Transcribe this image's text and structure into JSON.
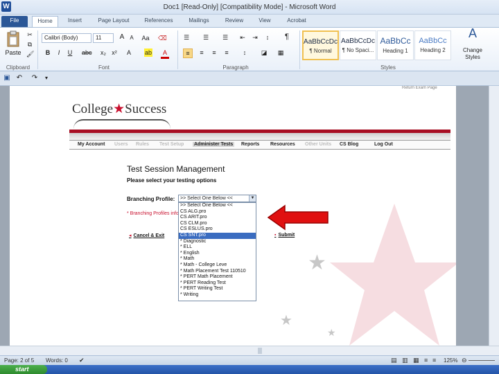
{
  "window": {
    "title": "Doc1 [Read-Only] [Compatibility Mode] - Microsoft Word",
    "app_icon": "W"
  },
  "tabs": [
    "File",
    "Home",
    "Insert",
    "Page Layout",
    "References",
    "Mailings",
    "Review",
    "View",
    "Acrobat"
  ],
  "ribbon": {
    "clipboard": {
      "paste": "Paste",
      "label": "Clipboard"
    },
    "font": {
      "family": "Calibri (Body)",
      "size": "11",
      "label": "Font"
    },
    "paragraph": {
      "label": "Paragraph"
    },
    "styles": {
      "items": [
        {
          "sample": "AaBbCcDc",
          "name": "¶ Normal"
        },
        {
          "sample": "AaBbCcDc",
          "name": "¶ No Spaci..."
        },
        {
          "sample": "AaBbCc",
          "name": "Heading 1"
        },
        {
          "sample": "AaBbCc",
          "name": "Heading 2"
        }
      ],
      "change": "Change Styles",
      "label": "Styles"
    }
  },
  "document": {
    "top_right_text": "Return Exam Page",
    "logo": {
      "left": "College",
      "star": "★",
      "right": "Success"
    },
    "nav": [
      "My Account",
      "Users",
      "Rules",
      "Test Setup",
      "Administer Tests",
      "Reports",
      "Resources",
      "Other Units",
      "CS Blog",
      "Log Out"
    ],
    "heading": "Test Session Management",
    "subheading": "Please select your testing options",
    "branching_label": "Branching Profile:",
    "select_value": ">> Select One Below <<",
    "note": "* Branching Profiles info",
    "options": [
      ">> Select One Below <<",
      "CS ALG.pro",
      "CS ARIT.pro",
      "CS CLM.pro",
      "CS ESLUS.pro",
      "CS SNT.pro",
      "* Diagnostic",
      "* ELL",
      "* English",
      "* Math",
      "* Math - College Leve",
      "* Math Placement Test 110510",
      "* PERT Math Placement",
      "* PERT Reading Test",
      "* PERT Writing Test",
      "* Writing"
    ],
    "highlighted_option": "CS SNT.pro",
    "cancel": "Cancel & Exit",
    "submit": "Submit"
  },
  "status": {
    "page": "Page: 2 of 5",
    "words": "Words: 0",
    "zoom": "125%"
  },
  "taskbar": {
    "start": "start"
  },
  "colors": {
    "accent_red": "#c8102e",
    "ribbon_blue": "#2b5797",
    "highlight": "#3a6cc0"
  }
}
